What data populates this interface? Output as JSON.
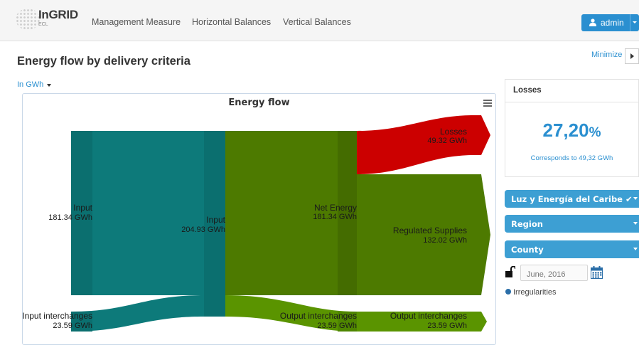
{
  "app": {
    "brand": "InGRID",
    "sub": "ECL"
  },
  "nav": {
    "items": [
      "Management Measure",
      "Horizontal Balances",
      "Vertical Balances"
    ]
  },
  "user": {
    "name": "admin"
  },
  "page": {
    "title": "Energy flow by delivery criteria",
    "minimize": "Minimize"
  },
  "unit_select": {
    "value": "In GWh"
  },
  "chart": {
    "title": "Energy flow",
    "colors": {
      "teal": "#0d7a7a",
      "green": "#4d7a00",
      "green_light": "#5a9400",
      "red": "#cc0000"
    },
    "nodes": {
      "input1": {
        "name": "Input",
        "value": "181.34 GWh"
      },
      "interchanges_in": {
        "name": "Input interchanges",
        "value": "23.59 GWh"
      },
      "input2": {
        "name": "Input",
        "value": "204.93 GWh"
      },
      "net": {
        "name": "Net Energy",
        "value": "181.34 GWh"
      },
      "out_inter_mid": {
        "name": "Output interchanges",
        "value": "23.59 GWh"
      },
      "losses": {
        "name": "Losses",
        "value": "49.32 GWh"
      },
      "regulated": {
        "name": "Regulated Supplies",
        "value": "132.02 GWh"
      },
      "out_inter_end": {
        "name": "Output interchanges",
        "value": "23.59 GWh"
      }
    }
  },
  "chart_data": {
    "type": "sankey",
    "title": "Energy flow",
    "unit": "GWh",
    "links": [
      {
        "source": "Input",
        "target": "Input",
        "value": 181.34
      },
      {
        "source": "Input interchanges",
        "target": "Input",
        "value": 23.59
      },
      {
        "source": "Input",
        "target": "Net Energy",
        "value": 181.34
      },
      {
        "source": "Input",
        "target": "Output interchanges",
        "value": 23.59
      },
      {
        "source": "Net Energy",
        "target": "Losses",
        "value": 49.32
      },
      {
        "source": "Net Energy",
        "target": "Regulated Supplies",
        "value": 132.02
      },
      {
        "source": "Output interchanges",
        "target": "Output interchanges",
        "value": 23.59
      }
    ]
  },
  "losses": {
    "title": "Losses",
    "percent": "27,20",
    "percent_symbol": "%",
    "corresponds": "Corresponds to 49,32 GWh"
  },
  "filters": [
    {
      "label": "Luz y Energía del Caribe ✔"
    },
    {
      "label": "Region"
    },
    {
      "label": "County"
    }
  ],
  "date": {
    "placeholder": "June, 2016"
  },
  "irregularities": {
    "label": "Irregularities"
  }
}
